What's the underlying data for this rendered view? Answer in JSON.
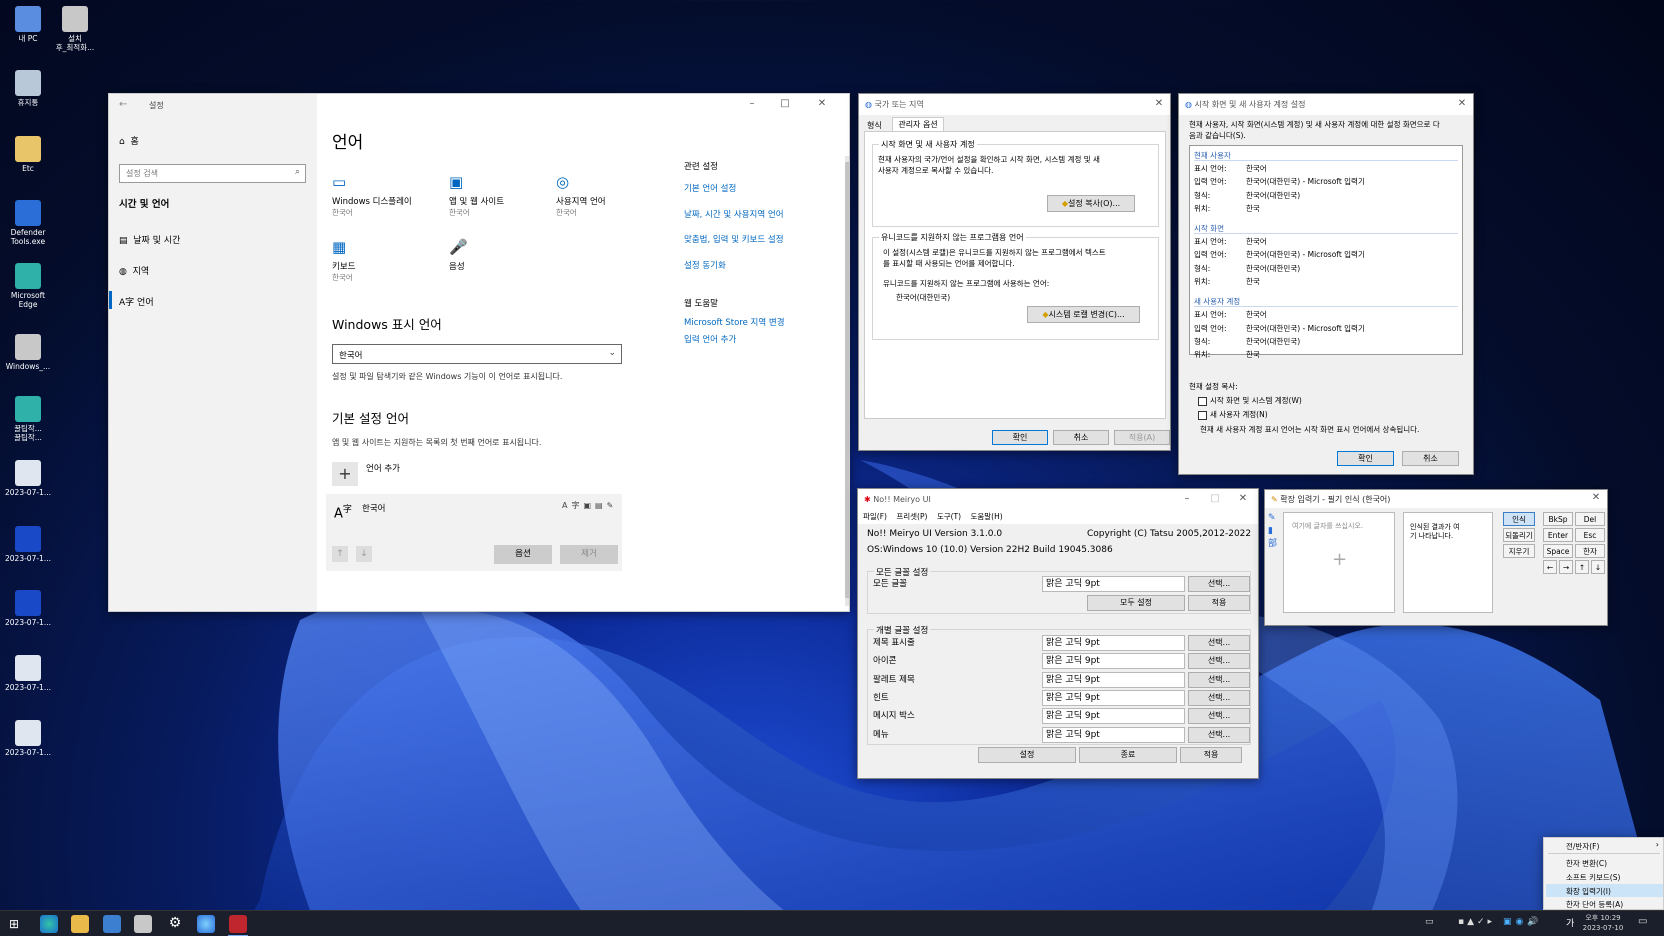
{
  "desktop": {
    "icons": [
      {
        "label": "내 PC",
        "color": "#5a8de0"
      },
      {
        "label": "설치\n후_최적화...",
        "color": "#c8c8c8"
      },
      {
        "label": "휴지통",
        "color": "#b8c8d8"
      },
      {
        "label": "Etc",
        "color": "#e9c56a"
      },
      {
        "label": "Defender\nTools.exe",
        "color": "#2b6ed8"
      },
      {
        "label": "Microsoft\nEdge",
        "color": "#2fb0a8"
      },
      {
        "label": "Windows_...",
        "color": "#c8c8c8"
      },
      {
        "label": "꿀팁작...\n꿀팁작...",
        "color": "#2fb0a8"
      },
      {
        "label": "2023-07-1...",
        "color": "#e0e6ef"
      },
      {
        "label": "2023-07-1...",
        "color": "#1a49c8"
      },
      {
        "label": "2023-07-1...",
        "color": "#1a49c8"
      },
      {
        "label": "2023-07-1...",
        "color": "#e0e6ef"
      },
      {
        "label": "2023-07-1...",
        "color": "#e0e6ef"
      }
    ]
  },
  "settings": {
    "title": "설정",
    "home": "홈",
    "search_placeholder": "설정 검색",
    "section": "시간 및 언어",
    "nav": [
      "날짜 및 시간",
      "지역",
      "언어"
    ],
    "page_title": "언어",
    "tiles": [
      {
        "label": "Windows 디스플레이",
        "sub": "한국어"
      },
      {
        "label": "앱 및 웹 사이트",
        "sub": "한국어"
      },
      {
        "label": "사용지역 언어",
        "sub": "한국어"
      },
      {
        "label": "키보드",
        "sub": "한국어"
      },
      {
        "label": "음성",
        "sub": ""
      }
    ],
    "display_lang_heading": "Windows 표시 언어",
    "display_lang_value": "한국어",
    "display_lang_desc": "설정 및 파일 탐색기와 같은 Windows 기능이 이 언어로 표시됩니다.",
    "pref_heading": "기본 설정 언어",
    "pref_desc": "앱 및 웹 사이트는 지원하는 목록의 첫 번째 언어로 표시됩니다.",
    "add_lang": "언어 추가",
    "lang_item": "한국어",
    "options_btn": "옵션",
    "remove_btn": "제거",
    "related_heading": "관련 설정",
    "related_links": [
      "기본 언어 설정",
      "날짜, 시간 및 사용지역 언어",
      "맞춤법, 입력 및 키보드 설정",
      "설정 동기화"
    ],
    "help_heading": "웹 도움말",
    "help_links": [
      "Microsoft Store 지역 변경",
      "입력 언어 추가"
    ]
  },
  "region": {
    "title": "국가 또는 지역",
    "tabs": [
      "형식",
      "관리자 옵션"
    ],
    "group1_label": "시작 화면 및 새 사용자 계정",
    "group1_text": "현재 사용자의 국가/언어 설정을 확인하고 시작 화면, 시스템 계정 및 새\n사용자 계정으로 복사할 수 있습니다.",
    "copy_btn": "설정 복사(O)...",
    "group2_label": "유니코드를 지원하지 않는 프로그램용 언어",
    "group2_text": "이 설정(시스템 로캘)은 유니코드를 지원하지 않는 프로그램에서 텍스트\n를 표시할 때 사용되는 언어를 제어합니다.",
    "current_label": "유니코드를 지원하지 않는 프로그램에 사용하는 언어:",
    "current_value": "한국어(대한민국)",
    "locale_btn": "시스템 로캘 변경(C)...",
    "ok": "확인",
    "cancel": "취소",
    "apply": "적용(A)"
  },
  "welcome": {
    "title": "시작 화면 및 새 사용자 계정 설정",
    "intro": "현재 사용자, 시작 화면(시스템 계정) 및 새 사용자 계정에 대한 설정 화면으로 다\n음과 같습니다(S).",
    "sections": [
      {
        "name": "현재 사용자",
        "rows": [
          [
            "표시 언어:",
            "한국어"
          ],
          [
            "입력 언어:",
            "한국어(대한민국) - Microsoft 입력기"
          ],
          [
            "형식:",
            "한국어(대한민국)"
          ],
          [
            "위치:",
            "한국"
          ]
        ]
      },
      {
        "name": "시작 화면",
        "rows": [
          [
            "표시 언어:",
            "한국어"
          ],
          [
            "입력 언어:",
            "한국어(대한민국) - Microsoft 입력기"
          ],
          [
            "형식:",
            "한국어(대한민국)"
          ],
          [
            "위치:",
            "한국"
          ]
        ]
      },
      {
        "name": "새 사용자 계정",
        "rows": [
          [
            "표시 언어:",
            "한국어"
          ],
          [
            "입력 언어:",
            "한국어(대한민국) - Microsoft 입력기"
          ],
          [
            "형식:",
            "한국어(대한민국)"
          ],
          [
            "위치:",
            "한국"
          ]
        ]
      }
    ],
    "copy_label": "현재 설정 복사:",
    "check1": "시작 화면 및 시스템 계정(W)",
    "check2": "새 사용자 계정(N)",
    "note": "현재 새 사용자 계정 표시 언어는 시작 화면 표시 언어에서 상속됩니다.",
    "ok": "확인",
    "cancel": "취소"
  },
  "meiryo": {
    "title": "No!! Meiryo UI",
    "menu": [
      "파일(F)",
      "프리셋(P)",
      "도구(T)",
      "도움말(H)"
    ],
    "version": "No!! Meiryo UI Version 3.1.0.0",
    "copyright": "Copyright (C) Tatsu 2005,2012-2022",
    "os": "OS:Windows 10 (10.0) Version 22H2 Build 19045.3086",
    "all_group": "모든 글꼴 설정",
    "all_label": "모든 글꼴",
    "font_value": "맑은 고딕   9pt",
    "select_btn": "선택...",
    "all_set_btn": "모두 설정",
    "apply_btn": "적용",
    "each_group": "개별 글꼴 설정",
    "rows": [
      "제목 표시줄",
      "아이콘",
      "팔레트 제목",
      "힌트",
      "메시지 박스",
      "메뉴"
    ],
    "bottom_btns": [
      "설정",
      "종료",
      "적용"
    ]
  },
  "handwriting": {
    "title": "확장 입력기 - 필기 인식 (한국어)",
    "placeholder": "여기에 글자를 쓰십시오.",
    "result_hint": "인식된 결과가 여\n기 나타납니다.",
    "side_btns": [
      "인식",
      "되돌리기",
      "지우기"
    ],
    "keys": [
      "BkSp",
      "Del",
      "Enter",
      "Esc",
      "Space",
      "한자"
    ],
    "arrows": [
      "←",
      "→",
      "↑",
      "↓"
    ]
  },
  "context_menu": {
    "items": [
      "전/반자(F)",
      "한자 변환(C)",
      "소프트 키보드(S)",
      "확장 입력기(I)",
      "한자 단어 등록(A)"
    ]
  },
  "taskbar": {
    "time": "오후 10:29",
    "date": "2023-07-10",
    "ime": "가"
  }
}
